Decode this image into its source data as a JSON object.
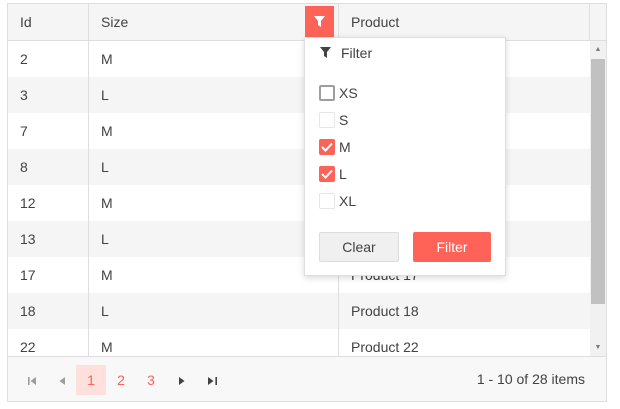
{
  "columns": [
    "Id",
    "Size",
    "Product"
  ],
  "rows": [
    {
      "id": "2",
      "size": "M",
      "product": ""
    },
    {
      "id": "3",
      "size": "L",
      "product": ""
    },
    {
      "id": "7",
      "size": "M",
      "product": ""
    },
    {
      "id": "8",
      "size": "L",
      "product": ""
    },
    {
      "id": "12",
      "size": "M",
      "product": ""
    },
    {
      "id": "13",
      "size": "L",
      "product": ""
    },
    {
      "id": "17",
      "size": "M",
      "product": "Product 17"
    },
    {
      "id": "18",
      "size": "L",
      "product": "Product 18"
    },
    {
      "id": "22",
      "size": "M",
      "product": "Product 22"
    }
  ],
  "filter_menu": {
    "title": "Filter",
    "options": [
      {
        "label": "XS",
        "checked": false
      },
      {
        "label": "S",
        "checked": false
      },
      {
        "label": "M",
        "checked": true
      },
      {
        "label": "L",
        "checked": true
      },
      {
        "label": "XL",
        "checked": false
      }
    ],
    "clear_label": "Clear",
    "filter_label": "Filter"
  },
  "pager": {
    "pages": [
      "1",
      "2",
      "3"
    ],
    "current_page": "1",
    "info": "1 - 10 of 28 items"
  },
  "colors": {
    "accent": "#ff6358",
    "active_page_bg": "#ffe0dd",
    "header_bg": "#f5f5f5",
    "alt_row_bg": "#f5f5f5"
  },
  "icons": [
    "filter-icon",
    "first-page-icon",
    "previous-page-icon",
    "next-page-icon",
    "last-page-icon",
    "scroll-up-icon",
    "scroll-down-icon",
    "checkmark-icon"
  ]
}
